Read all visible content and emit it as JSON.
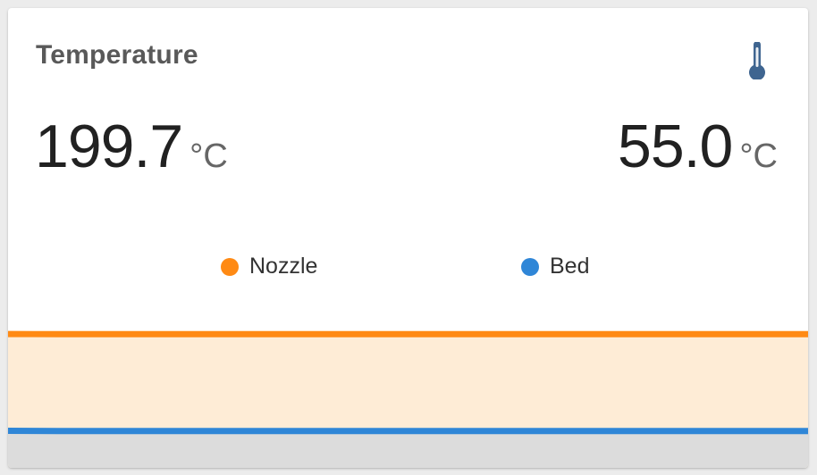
{
  "card": {
    "title": "Temperature",
    "icon": "thermometer-icon"
  },
  "readings": {
    "nozzle": {
      "value": "199.7",
      "unit": "°C"
    },
    "bed": {
      "value": "55.0",
      "unit": "°C"
    }
  },
  "colors": {
    "nozzle": "#ff8a14",
    "nozzle_fill": "#feecd6",
    "bed": "#2f86d7",
    "bed_fill": "#dcdcdc",
    "icon": "#3f6590"
  },
  "chart_data": {
    "type": "area",
    "x": [
      0,
      1,
      2,
      3,
      4,
      5,
      6,
      7,
      8,
      9,
      10,
      11,
      12,
      13,
      14,
      15,
      16
    ],
    "ylim": [
      0,
      200
    ],
    "title": "",
    "xlabel": "",
    "ylabel": "",
    "grid": false,
    "legend_position": "top-center",
    "series": [
      {
        "name": "Nozzle",
        "values": [
          199.9,
          199.6,
          199.6,
          199.7,
          199.6,
          199.7,
          199.6,
          199.7,
          199.6,
          199.7,
          199.6,
          199.7,
          199.6,
          199.7,
          199.6,
          199.7,
          199.7
        ]
      },
      {
        "name": "Bed",
        "values": [
          55.4,
          55.0,
          55.0,
          55.0,
          55.0,
          55.0,
          55.0,
          55.0,
          55.0,
          55.0,
          55.0,
          55.0,
          55.0,
          55.0,
          55.0,
          55.0,
          55.0
        ]
      }
    ]
  }
}
